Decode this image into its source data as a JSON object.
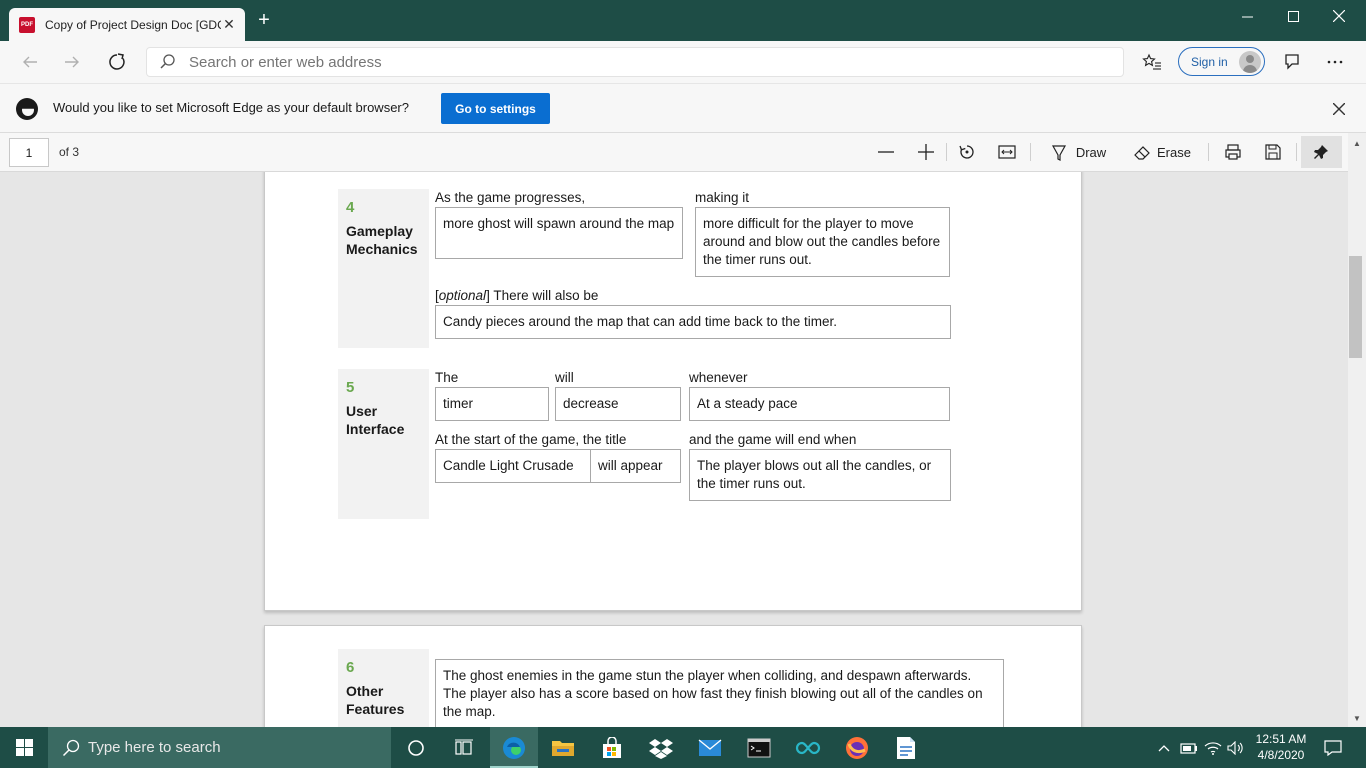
{
  "browser": {
    "tab_title": "Copy of Project Design Doc [GDC",
    "tab_favicon_text": "PDF",
    "address_placeholder": "Search or enter web address",
    "signin_label": "Sign in"
  },
  "infobar": {
    "message": "Would you like to set Microsoft Edge as your default browser?",
    "button_label": "Go to settings"
  },
  "pdf_toolbar": {
    "page_number": "1",
    "page_of": "of 3",
    "draw_label": "Draw",
    "erase_label": "Erase"
  },
  "document": {
    "section4": {
      "number": "4",
      "title": "Gameplay Mechanics",
      "label_progress": "As the game progresses,",
      "box_progress": "more ghost will spawn around the map",
      "label_making": "making it",
      "box_making": "more difficult for the player to move around and blow out the candles before the timer runs out.",
      "label_optional_italic": "optional",
      "label_optional_rest": " There will also be",
      "box_optional": "Candy pieces around the map that can add time back to the timer."
    },
    "section5": {
      "number": "5",
      "title": "User Interface",
      "label_the": "The",
      "box_the": "timer",
      "label_will": "will",
      "box_will": "decrease",
      "label_whenever": "whenever",
      "box_whenever": "At a steady pace",
      "label_start": "At the start of the game, the title",
      "box_title": "Candle Light Crusade",
      "box_appear": "will appear",
      "label_end": "and the game will end when",
      "box_end": "The player blows out all the candles, or the timer runs out."
    },
    "section6": {
      "number": "6",
      "title": "Other Features",
      "box_features": "The ghost enemies in the game stun the player when colliding, and despawn afterwards. The player also has a score based on how fast they finish blowing out all of the candles on the map."
    }
  },
  "taskbar": {
    "search_placeholder": "Type here to search",
    "time": "12:51 AM",
    "date": "4/8/2020"
  }
}
